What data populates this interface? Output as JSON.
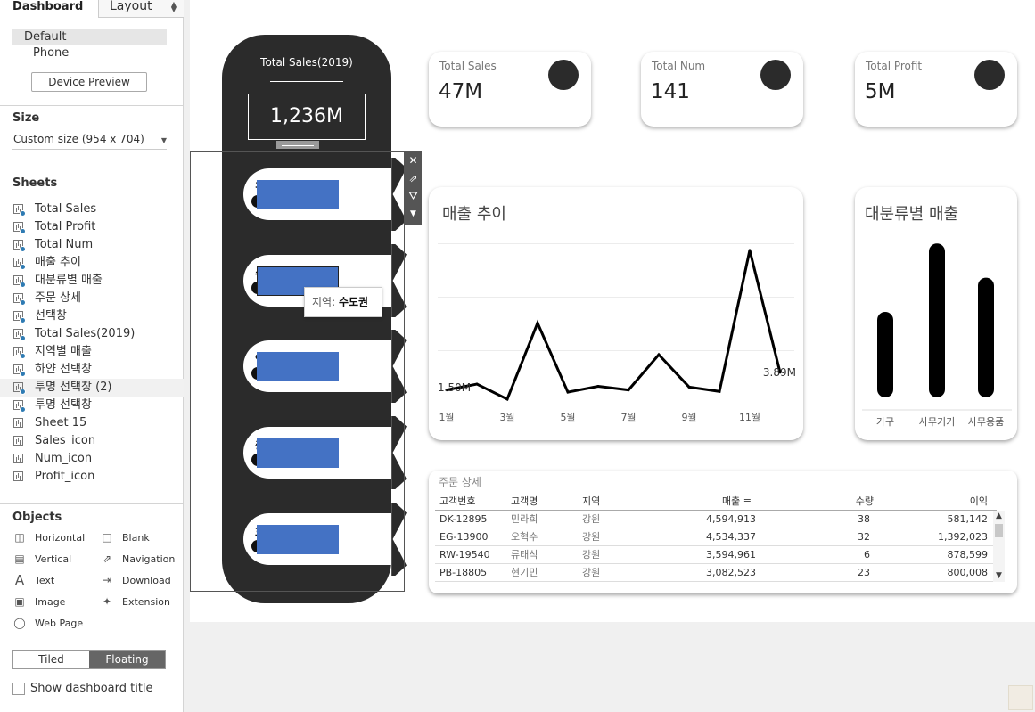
{
  "left_panel": {
    "tabs": {
      "dashboard": "Dashboard",
      "layout": "Layout"
    },
    "devices": {
      "default": "Default",
      "phone": "Phone",
      "preview_button": "Device Preview"
    },
    "size": {
      "title": "Size",
      "value": "Custom size (954 x 704)"
    },
    "sheets": {
      "title": "Sheets",
      "items": [
        "Total Sales",
        "Total Profit",
        "Total Num",
        "매출 추이",
        "대분류별 매출",
        "주문 상세",
        "선택창",
        "Total Sales(2019)",
        "지역별 매출",
        "하얀 선택창",
        "투명 선택창 (2)",
        "투명 선택창",
        "Sheet 15",
        "Sales_icon",
        "Num_icon",
        "Profit_icon"
      ],
      "active_index": 10
    },
    "objects": {
      "title": "Objects",
      "items": [
        {
          "label": "Horizontal",
          "icon": "horizontal-layout-icon"
        },
        {
          "label": "Blank",
          "icon": "blank-icon"
        },
        {
          "label": "Vertical",
          "icon": "vertical-layout-icon"
        },
        {
          "label": "Navigation",
          "icon": "navigation-icon"
        },
        {
          "label": "Text",
          "icon": "text-icon"
        },
        {
          "label": "Download",
          "icon": "download-icon"
        },
        {
          "label": "Image",
          "icon": "image-icon"
        },
        {
          "label": "Extension",
          "icon": "extension-icon"
        },
        {
          "label": "Web Page",
          "icon": "globe-icon"
        }
      ]
    },
    "layout_mode": {
      "tiled": "Tiled",
      "floating": "Floating",
      "selected": "Floating"
    },
    "show_title": {
      "label": "Show dashboard title",
      "checked": false
    }
  },
  "sidebar": {
    "title": "Total Sales(2019)",
    "total": "1,236M",
    "regions": [
      {
        "label": "경",
        "value": 0.45
      },
      {
        "label": "수도권",
        "value": 0.45
      },
      {
        "label": "영남",
        "value": 0.45
      },
      {
        "label": "충청",
        "value": 0.45
      },
      {
        "label": "호남",
        "value": 0.45
      }
    ],
    "tooltip": {
      "key": "지역: ",
      "value": "수도권"
    },
    "region_colors": {
      "bar": "#4472c4",
      "pill": "#2b2b2b"
    }
  },
  "kpis": [
    {
      "title": "Total Sales",
      "value": "47M"
    },
    {
      "title": "Total Num",
      "value": "141"
    },
    {
      "title": "Total Profit",
      "value": "5M"
    }
  ],
  "chart_data": [
    {
      "type": "line",
      "title": "매출 추이",
      "x": [
        "1월",
        "2월",
        "3월",
        "4월",
        "5월",
        "6월",
        "7월",
        "8월",
        "9월",
        "10월",
        "11월",
        "12월"
      ],
      "tick_labels": [
        "1월",
        "3월",
        "5월",
        "7월",
        "9월",
        "11월"
      ],
      "values": [
        1.5,
        2.3,
        0.25,
        10.6,
        1.2,
        2.0,
        1.5,
        6.3,
        1.9,
        1.3,
        20.5,
        3.89
      ],
      "annotations": {
        "first": "1.50M",
        "last": "3.89M"
      },
      "ylim": [
        0,
        24
      ],
      "grid": true,
      "color": "#000000"
    },
    {
      "type": "bar",
      "title": "대분류별 매출",
      "categories": [
        "가구",
        "사무기기",
        "사무용품"
      ],
      "values": [
        12.5,
        22.5,
        17.5
      ],
      "ylim": [
        0,
        25
      ],
      "color": "#000000"
    }
  ],
  "orders": {
    "title": "주문 상세",
    "columns": [
      "고객번호",
      "고객명",
      "지역",
      "매출",
      "수량",
      "이익"
    ],
    "sort_icon": "sort-descending-icon",
    "rows": [
      [
        "DK-12895",
        "민라희",
        "강원",
        "4,594,913",
        "38",
        "581,142"
      ],
      [
        "EG-13900",
        "오혁수",
        "강원",
        "4,534,337",
        "32",
        "1,392,023"
      ],
      [
        "RW-19540",
        "류태식",
        "강원",
        "3,594,961",
        "6",
        "878,599"
      ],
      [
        "PB-18805",
        "현기민",
        "강원",
        "3,082,523",
        "23",
        "800,008"
      ]
    ]
  }
}
